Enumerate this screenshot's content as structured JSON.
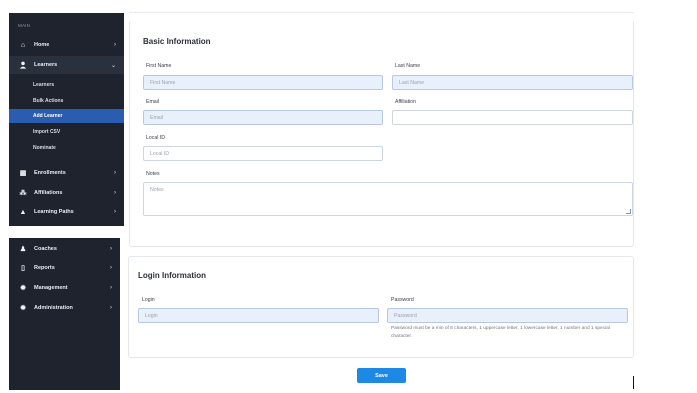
{
  "sidebar": {
    "section_label": "MAIN",
    "top_items": [
      {
        "label": "Home",
        "icon": "home-icon",
        "glyph": "⌂",
        "chevron": "›"
      },
      {
        "label": "Learners",
        "icon": "learners-icon",
        "glyph": "👤",
        "chevron": "⌄"
      }
    ],
    "learner_subitems": [
      {
        "label": "Learners"
      },
      {
        "label": "Bulk Actions"
      },
      {
        "label": "Add Learner"
      },
      {
        "label": "Import CSV"
      },
      {
        "label": "Nominate"
      }
    ],
    "mid_items": [
      {
        "label": "Enrollments",
        "icon": "calendar-icon",
        "glyph": "▦",
        "chevron": "›"
      },
      {
        "label": "Affiliations",
        "icon": "org-chart-icon",
        "glyph": "⁂",
        "chevron": "›"
      },
      {
        "label": "Learning Paths",
        "icon": "graduation-cap-icon",
        "glyph": "▲",
        "chevron": "›"
      }
    ],
    "bottom_items": [
      {
        "label": "Coaches",
        "icon": "coach-icon",
        "glyph": "♟",
        "chevron": "›"
      },
      {
        "label": "Reports",
        "icon": "reports-icon",
        "glyph": "▯",
        "chevron": "›"
      },
      {
        "label": "Management",
        "icon": "gear-icon",
        "glyph": "✹",
        "chevron": "›"
      },
      {
        "label": "Administration",
        "icon": "gear-icon",
        "glyph": "✹",
        "chevron": "›"
      }
    ]
  },
  "basic": {
    "title": "Basic Information",
    "first_name": {
      "label": "First Name",
      "placeholder": "First Name"
    },
    "last_name": {
      "label": "Last Name",
      "placeholder": "Last Name"
    },
    "email": {
      "label": "Email",
      "placeholder": "Email"
    },
    "affiliation": {
      "label": "Affiliation",
      "placeholder": ""
    },
    "local_id": {
      "label": "Local ID",
      "placeholder": "Local ID"
    },
    "notes": {
      "label": "Notes",
      "placeholder": "Notes"
    }
  },
  "login": {
    "title": "Login Information",
    "login": {
      "label": "Login",
      "placeholder": "Login"
    },
    "password": {
      "label": "Password",
      "placeholder": "Password",
      "hint": "Password must be a min of 8 characters, 1 uppercase letter, 1 lowercase letter, 1 number and 1 special character."
    }
  },
  "actions": {
    "save_label": "Save"
  }
}
